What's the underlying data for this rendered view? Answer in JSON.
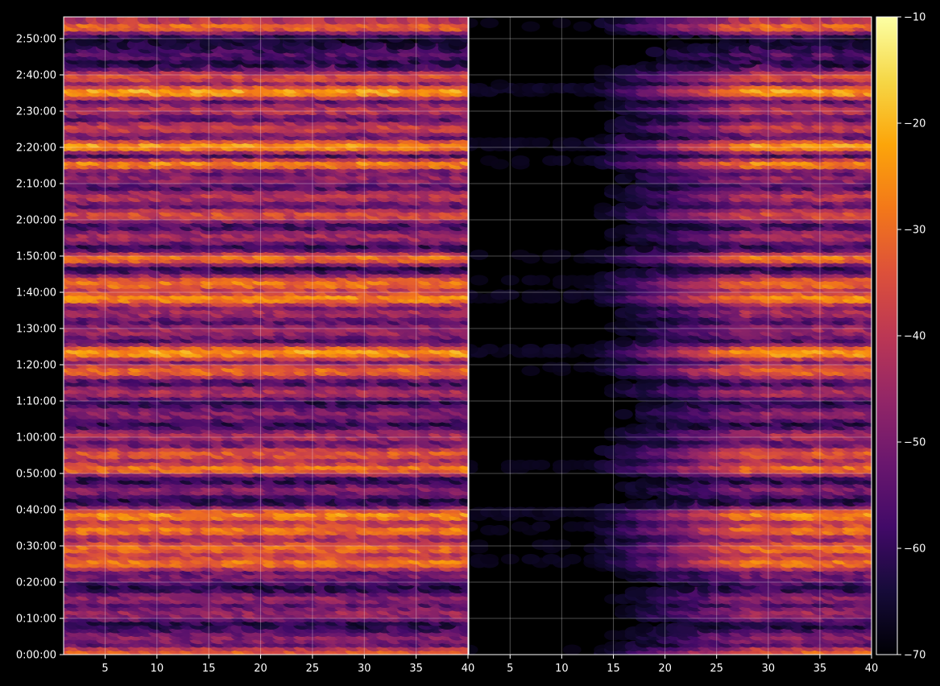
{
  "chart_data": {
    "type": "heatmap",
    "panels": [
      {
        "name": "left",
        "xlim": [
          1,
          40
        ],
        "x_ticks": [
          5,
          10,
          15,
          20,
          25,
          30,
          35,
          40
        ],
        "x_tick_labels": [
          "5",
          "10",
          "15",
          "20",
          "25",
          "30",
          "35",
          "40"
        ],
        "pattern": "full_spread"
      },
      {
        "name": "right",
        "xlim": [
          1,
          40
        ],
        "x_ticks": [
          5,
          10,
          15,
          20,
          25,
          30,
          35,
          40
        ],
        "x_tick_labels": [
          "5",
          "10",
          "15",
          "20",
          "25",
          "30",
          "35",
          "40"
        ],
        "pattern": "rising_with_x"
      }
    ],
    "y_axis": {
      "unit": "seconds",
      "ylim": [
        0,
        10560
      ],
      "ticks": [
        0,
        600,
        1200,
        1800,
        2400,
        3000,
        3600,
        4200,
        4800,
        5400,
        6000,
        6600,
        7200,
        7800,
        8400,
        9000,
        9600,
        10200
      ],
      "tick_labels": [
        "0:00:00",
        "0:10:00",
        "0:20:00",
        "0:30:00",
        "0:40:00",
        "0:50:00",
        "1:00:00",
        "1:10:00",
        "1:20:00",
        "1:30:00",
        "1:40:00",
        "1:50:00",
        "2:00:00",
        "2:10:00",
        "2:20:00",
        "2:30:00",
        "2:40:00",
        "2:50:00"
      ]
    },
    "colorbar": {
      "colormap": "inferno",
      "range": [
        -70,
        -10
      ],
      "ticks": [
        -70,
        -60,
        -50,
        -40,
        -30,
        -20,
        -10
      ],
      "tick_labels": [
        "−70",
        "−60",
        "−50",
        "−40",
        "−30",
        "−20",
        "−10"
      ]
    },
    "bands": [
      {
        "t": 60,
        "level": -32,
        "width": 150
      },
      {
        "t": 300,
        "level": -48,
        "width": 180
      },
      {
        "t": 720,
        "level": -45,
        "width": 160
      },
      {
        "t": 960,
        "level": -47,
        "width": 150
      },
      {
        "t": 1320,
        "level": -50,
        "width": 160
      },
      {
        "t": 1560,
        "level": -28,
        "width": 170
      },
      {
        "t": 1800,
        "level": -30,
        "width": 200
      },
      {
        "t": 2100,
        "level": -28,
        "width": 170
      },
      {
        "t": 2340,
        "level": -25,
        "width": 160
      },
      {
        "t": 2760,
        "level": -48,
        "width": 150
      },
      {
        "t": 3120,
        "level": -28,
        "width": 140
      },
      {
        "t": 3360,
        "level": -33,
        "width": 170
      },
      {
        "t": 3660,
        "level": -43,
        "width": 160
      },
      {
        "t": 4020,
        "level": -48,
        "width": 170
      },
      {
        "t": 4380,
        "level": -42,
        "width": 150
      },
      {
        "t": 4740,
        "level": -30,
        "width": 170
      },
      {
        "t": 5040,
        "level": -23,
        "width": 160
      },
      {
        "t": 5400,
        "level": -45,
        "width": 200
      },
      {
        "t": 5700,
        "level": -43,
        "width": 160
      },
      {
        "t": 5940,
        "level": -25,
        "width": 160
      },
      {
        "t": 6180,
        "level": -28,
        "width": 180
      },
      {
        "t": 6600,
        "level": -28,
        "width": 130
      },
      {
        "t": 6960,
        "level": -43,
        "width": 160
      },
      {
        "t": 7320,
        "level": -35,
        "width": 160
      },
      {
        "t": 7620,
        "level": -40,
        "width": 160
      },
      {
        "t": 7920,
        "level": -46,
        "width": 160
      },
      {
        "t": 8160,
        "level": -25,
        "width": 120
      },
      {
        "t": 8460,
        "level": -23,
        "width": 140
      },
      {
        "t": 8760,
        "level": -38,
        "width": 160
      },
      {
        "t": 9060,
        "level": -40,
        "width": 160
      },
      {
        "t": 9360,
        "level": -22,
        "width": 150
      },
      {
        "t": 9600,
        "level": -35,
        "width": 150
      },
      {
        "t": 9960,
        "level": -55,
        "width": 140
      },
      {
        "t": 10440,
        "level": -30,
        "width": 140
      }
    ]
  }
}
